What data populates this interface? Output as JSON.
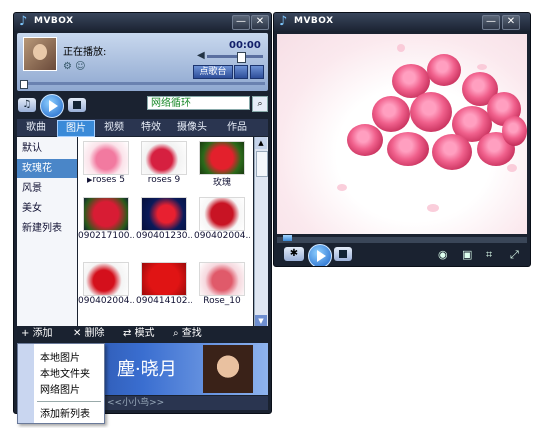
{
  "left_window": {
    "title": "MVBOX",
    "now_playing_label": "正在播放:",
    "time": "00:00",
    "vod_button": "点歌台",
    "play_mode": "网络循环",
    "tabs": [
      "歌曲",
      "图片",
      "视频",
      "特效",
      "摄像头",
      "作品"
    ],
    "active_tab": "图片",
    "sidebar_items": [
      "默认",
      "玫瑰花",
      "风景",
      "美女",
      "新建列表"
    ],
    "selected_sidebar": "玫瑰花",
    "thumbnails": [
      {
        "caption": "roses 5"
      },
      {
        "caption": "roses 9"
      },
      {
        "caption": "玫瑰"
      },
      {
        "caption": "090217100..."
      },
      {
        "caption": "090401230..."
      },
      {
        "caption": "090402004..."
      },
      {
        "caption": "090402004..."
      },
      {
        "caption": "090414102..."
      },
      {
        "caption": "Rose_10"
      }
    ],
    "toolbar": {
      "add": "添加",
      "delete": "删除",
      "mode": "模式",
      "find": "查找"
    },
    "banner_text": "塵·晓月",
    "banner_footer": "<<小小鸟>>",
    "popup_menu": [
      "本地图片",
      "本地文件夹",
      "网络图片",
      "添加新列表"
    ]
  },
  "right_window": {
    "title": "MVBOX"
  },
  "colors": {
    "frame": "#1a2230",
    "accent": "#3a8ad8",
    "rose": "#f0608c"
  },
  "icons": [
    "note-icon",
    "minimize-icon",
    "close-icon",
    "play-icon",
    "stop-icon",
    "search-icon",
    "fullscreen-icon"
  ]
}
